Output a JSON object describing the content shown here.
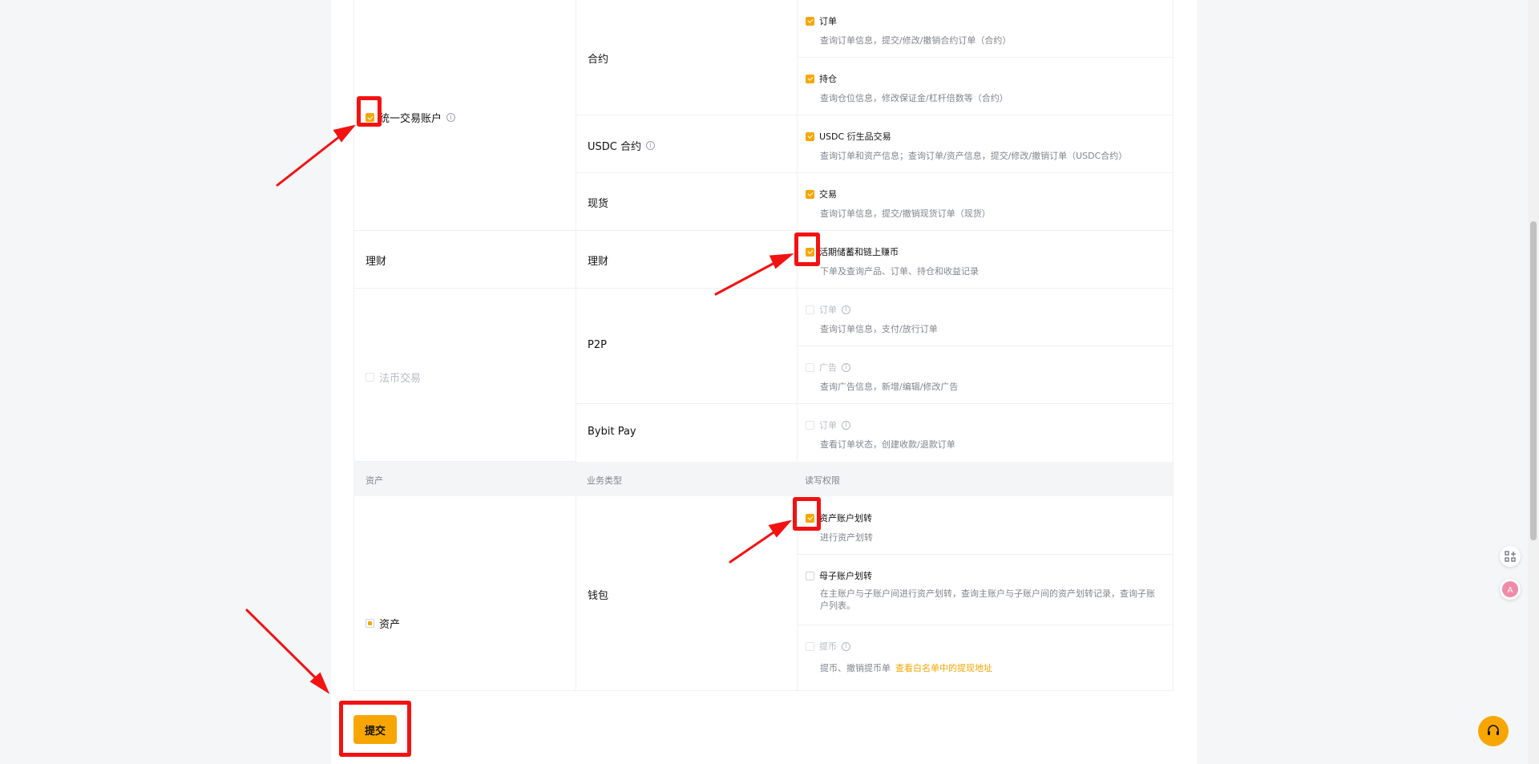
{
  "categories": {
    "unified": "统一交易账户",
    "earn": "理财",
    "fiat": "法币交易",
    "assets": "资产"
  },
  "business": {
    "contract": "合约",
    "usdc": "USDC 合约",
    "spot": "现货",
    "earn": "理财",
    "p2p": "P2P",
    "bybitpay": "Bybit Pay",
    "wallet": "钱包"
  },
  "permissions": {
    "contract_order": {
      "label": "订单",
      "desc": "查询订单信息，提交/修改/撤销合约订单（合约）",
      "state": "checked"
    },
    "contract_position": {
      "label": "持仓",
      "desc": "查询仓位信息，修改保证金/杠杆倍数等（合约）",
      "state": "checked"
    },
    "usdc_deriv": {
      "label": "USDC 衍生品交易",
      "desc": "查询订单和资产信息；查询订单/资产信息，提交/修改/撤销订单（USDC合约）",
      "state": "checked"
    },
    "spot_trade": {
      "label": "交易",
      "desc": "查询订单信息，提交/撤销现货订单（现货）",
      "state": "checked"
    },
    "earn_savings": {
      "label": "活期储蓄和链上赚币",
      "desc": "下单及查询产品、订单、持仓和收益记录",
      "state": "checked"
    },
    "p2p_order": {
      "label": "订单",
      "desc": "查询订单信息，支付/放行订单",
      "state": "disabled"
    },
    "p2p_ad": {
      "label": "广告",
      "desc": "查询广告信息，新增/编辑/修改广告",
      "state": "disabled"
    },
    "pay_order": {
      "label": "订单",
      "desc": "查看订单状态，创建收款/退款订单",
      "state": "disabled"
    },
    "asset_transfer": {
      "label": "资产账户划转",
      "desc": "进行资产划转",
      "state": "checked"
    },
    "sub_transfer": {
      "label": "母子账户划转",
      "desc": "在主账户与子账户间进行资产划转，查询主账户与子账户间的资产划转记录，查询子账户列表。",
      "state": "unchecked"
    },
    "withdraw": {
      "label": "提币",
      "desc": "提币、撤销提币单",
      "link": "查看白名单中的提现地址",
      "state": "disabled"
    }
  },
  "table_header": {
    "col1": "资产",
    "col2": "业务类型",
    "col3": "读写权限"
  },
  "submit_label": "提交",
  "colors": {
    "accent": "#f7a600",
    "annotation": "#f31212"
  },
  "icons": {
    "info": "info-circle-icon",
    "support": "headset-icon",
    "scan": "scan-icon",
    "translate": "translate-icon"
  }
}
